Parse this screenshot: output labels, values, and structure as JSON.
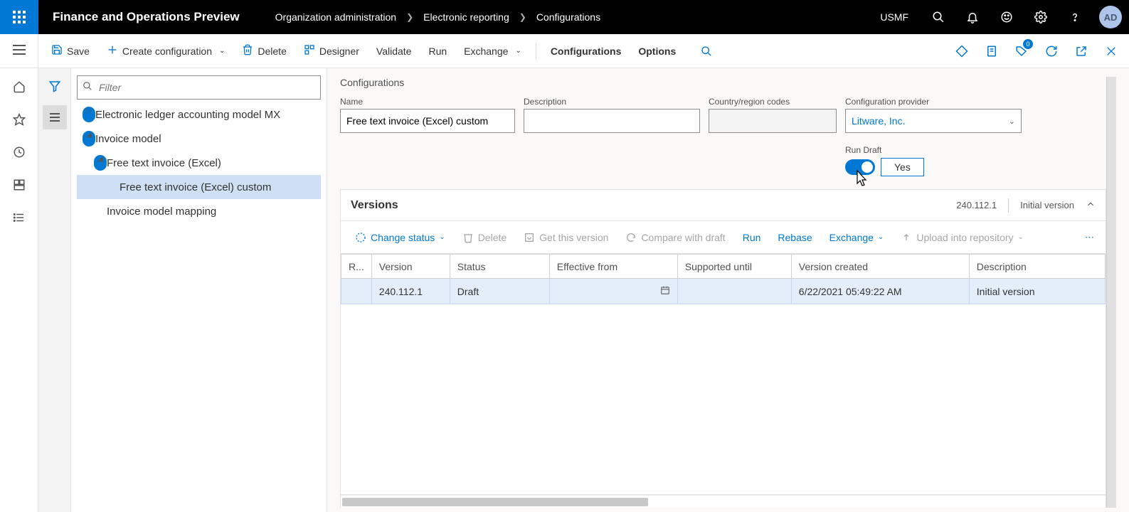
{
  "header": {
    "app_title": "Finance and Operations Preview",
    "company": "USMF",
    "avatar": "AD",
    "breadcrumbs": [
      "Organization administration",
      "Electronic reporting",
      "Configurations"
    ]
  },
  "actionbar": {
    "save": "Save",
    "create_configuration": "Create configuration",
    "delete": "Delete",
    "designer": "Designer",
    "validate": "Validate",
    "run": "Run",
    "exchange": "Exchange",
    "configurations_tab": "Configurations",
    "options_tab": "Options",
    "badge_count": "0"
  },
  "tree": {
    "filter_placeholder": "Filter",
    "nodes": {
      "n0": "Electronic ledger accounting model MX",
      "n1": "Invoice model",
      "n2": "Free text invoice (Excel)",
      "n3": "Free text invoice (Excel) custom",
      "n4": "Invoice model mapping"
    }
  },
  "config_section": {
    "title": "Configurations",
    "name_label": "Name",
    "name_value": "Free text invoice (Excel) custom",
    "description_label": "Description",
    "description_value": "",
    "region_label": "Country/region codes",
    "region_value": "",
    "provider_label": "Configuration provider",
    "provider_value": "Litware, Inc.",
    "run_draft_label": "Run Draft",
    "run_draft_value": "Yes"
  },
  "versions": {
    "title": "Versions",
    "summary_version": "240.112.1",
    "summary_desc": "Initial version",
    "toolbar": {
      "change_status": "Change status",
      "delete": "Delete",
      "get_this_version": "Get this version",
      "compare": "Compare with draft",
      "run": "Run",
      "rebase": "Rebase",
      "exchange": "Exchange",
      "upload": "Upload into repository"
    },
    "columns": {
      "r": "R...",
      "version": "Version",
      "status": "Status",
      "effective_from": "Effective from",
      "supported_until": "Supported until",
      "version_created": "Version created",
      "description": "Description"
    },
    "rows": [
      {
        "version": "240.112.1",
        "status": "Draft",
        "effective_from": "",
        "supported_until": "",
        "version_created": "6/22/2021 05:49:22 AM",
        "description": "Initial version"
      }
    ]
  }
}
